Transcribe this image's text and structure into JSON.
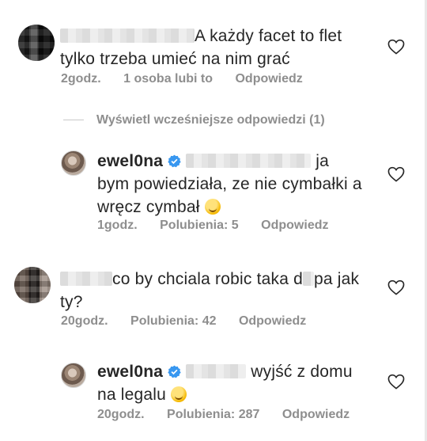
{
  "comments": [
    {
      "text_line1": "A każdy facet to flet",
      "text_line2": "tylko trzeba umieć na nim grać",
      "time": "2godz.",
      "likes": "1 osoba lubi to",
      "reply": "Odpowiedz"
    },
    {
      "view_earlier": "Wyświetl wcześniejsze odpowiedzi (1)"
    },
    {
      "username": "ewel0na",
      "text_line1_end": "ja",
      "text_line2": "bym powiedziała, ze nie cymbałki a",
      "text_line3": "wręcz cymbał",
      "time": "1godz.",
      "likes": "Polubienia: 5",
      "reply": "Odpowiedz"
    },
    {
      "text_line1": "co by chciala robic taka d",
      "text_line1_end": "pa jak",
      "text_line2": "ty?",
      "time": "20godz.",
      "likes": "Polubienia: 42",
      "reply": "Odpowiedz"
    },
    {
      "username": "ewel0na",
      "text_line1": "wyjść z domu",
      "text_line2": "na legalu",
      "time": "20godz.",
      "likes": "Polubienia: 287",
      "reply": "Odpowiedz"
    }
  ],
  "icons": {
    "heart": "heart-outline-icon",
    "verified": "verified-badge-icon",
    "emoji": "rolling-on-floor-laughing-emoji"
  },
  "colors": {
    "text": "#262626",
    "meta": "#8e8e8e",
    "verified": "#3897f0"
  }
}
